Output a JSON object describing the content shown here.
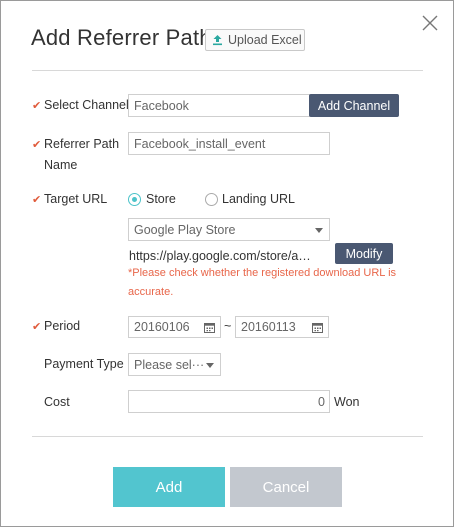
{
  "dialog": {
    "title": "Add Referrer Path",
    "upload_label": "Upload Excel"
  },
  "form": {
    "select_channel": {
      "label": "Select Channel",
      "value": "Facebook",
      "button": "Add Channel"
    },
    "referrer_path": {
      "label_line1": "Referrer Path",
      "label_line2": "Name",
      "value": "Facebook_install_event"
    },
    "target_url": {
      "label": "Target URL",
      "radio_store": "Store",
      "radio_landing": "Landing URL",
      "selected": "Store",
      "store_select": "Google Play Store",
      "url_value": "https://play.google.com/store/a…",
      "modify_button": "Modify",
      "warning_line1": "*Please check whether the registered download URL is",
      "warning_line2": "accurate."
    },
    "period": {
      "label": "Period",
      "start": "20160106",
      "separator": "~",
      "end": "20160113"
    },
    "payment_type": {
      "label": "Payment Type",
      "placeholder": "Please sel···"
    },
    "cost": {
      "label": "Cost",
      "value": "0",
      "unit": "Won"
    }
  },
  "actions": {
    "add": "Add",
    "cancel": "Cancel"
  },
  "colors": {
    "required_mark": "#e05a3a",
    "accent": "#52c5cf",
    "dark_button": "#4a5872",
    "warning": "#e8664a"
  }
}
